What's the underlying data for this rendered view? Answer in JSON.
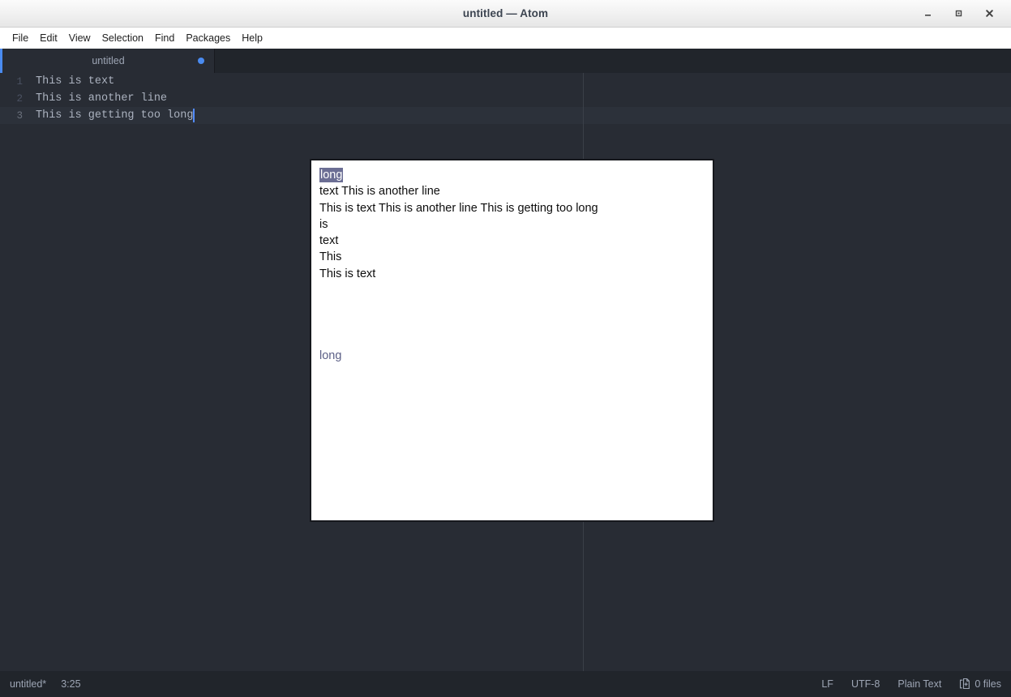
{
  "window": {
    "title": "untitled — Atom",
    "controls": [
      {
        "name": "minimize-button",
        "label": "–"
      },
      {
        "name": "maximize-button",
        "label": "▫"
      },
      {
        "name": "close-button",
        "label": "✕"
      }
    ]
  },
  "menubar": {
    "items": [
      {
        "label": "File"
      },
      {
        "label": "Edit"
      },
      {
        "label": "View"
      },
      {
        "label": "Selection"
      },
      {
        "label": "Find"
      },
      {
        "label": "Packages"
      },
      {
        "label": "Help"
      }
    ]
  },
  "tabs": [
    {
      "label": "untitled",
      "modified": true
    }
  ],
  "editor": {
    "lines": [
      {
        "number": "1",
        "text": "This is text",
        "active": false
      },
      {
        "number": "2",
        "text": "This is another line",
        "active": false
      },
      {
        "number": "3",
        "text": "This is getting too long",
        "active": true
      }
    ]
  },
  "popup": {
    "lines": [
      {
        "selected_text": "long",
        "text": ""
      },
      {
        "text": "text This is another line"
      },
      {
        "text": "This is text This is another line This is getting too long"
      },
      {
        "text": "is"
      },
      {
        "text": "text"
      },
      {
        "text": "This"
      },
      {
        "text": "This is text"
      }
    ],
    "muted_line": "long"
  },
  "statusbar": {
    "left": [
      {
        "name": "file-name",
        "label": "untitled*"
      },
      {
        "name": "cursor-position",
        "label": "3:25"
      }
    ],
    "right": [
      {
        "name": "line-ending",
        "label": "LF"
      },
      {
        "name": "encoding",
        "label": "UTF-8"
      },
      {
        "name": "grammar",
        "label": "Plain Text"
      },
      {
        "name": "git-changed-files",
        "label": "0 files"
      }
    ]
  },
  "colors": {
    "editor_bg": "#282c34",
    "tabbar_bg": "#21252b",
    "accent": "#4a8bf0",
    "text": "#abb2bf",
    "selection": "#6b6e94"
  }
}
